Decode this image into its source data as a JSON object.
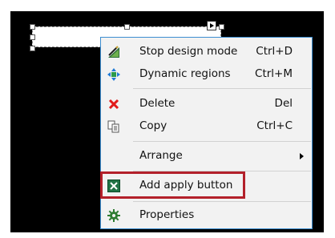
{
  "context_menu": {
    "items": [
      {
        "label": "Stop design mode",
        "shortcut": "Ctrl+D",
        "icon": "design-mode-icon"
      },
      {
        "label": "Dynamic regions",
        "shortcut": "Ctrl+M",
        "icon": "dynamic-regions-icon"
      },
      {
        "label": "Delete",
        "shortcut": "Del",
        "icon": "delete-icon"
      },
      {
        "label": "Copy",
        "shortcut": "Ctrl+C",
        "icon": "copy-icon"
      },
      {
        "label": "Arrange",
        "shortcut": "",
        "icon": "",
        "has_submenu": true
      },
      {
        "label": "Add apply button",
        "shortcut": "",
        "icon": "add-apply-button-icon"
      },
      {
        "label": "Properties",
        "shortcut": "",
        "icon": "gear-icon"
      }
    ]
  },
  "colors": {
    "menu_border": "#3c8dd0",
    "menu_background": "#f2f2f2",
    "highlight_border": "#b3202a",
    "delete_icon": "#e11b1b",
    "excel_green": "#217346",
    "canvas": "#000000"
  }
}
